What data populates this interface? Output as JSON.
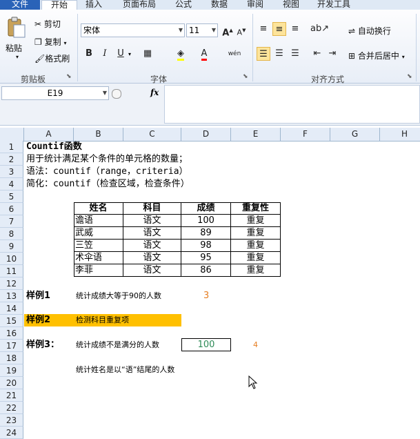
{
  "tabs": [
    "文件",
    "开始",
    "插入",
    "页面布局",
    "公式",
    "数据",
    "审阅",
    "视图",
    "开发工具"
  ],
  "clipboard": {
    "paste": "粘贴",
    "cut": "剪切",
    "copy": "复制",
    "painter": "格式刷",
    "group": "剪贴板"
  },
  "font": {
    "name": "宋体",
    "size": "11",
    "group": "字体",
    "bold": "B",
    "italic": "I",
    "underline": "U",
    "grow": "A",
    "shrink": "A"
  },
  "align": {
    "wrap": "自动换行",
    "merge": "合并后居中",
    "group": "对齐方式"
  },
  "formula_bar": {
    "name_box": "E19",
    "fx": "fx",
    "content": ""
  },
  "columns": [
    "A",
    "B",
    "C",
    "D",
    "E",
    "F",
    "G",
    "H"
  ],
  "rows": [
    "1",
    "2",
    "3",
    "4",
    "5",
    "6",
    "7",
    "8",
    "9",
    "10",
    "11",
    "12",
    "13",
    "14",
    "15",
    "16",
    "17",
    "18",
    "19",
    "20",
    "21",
    "22",
    "23",
    "24"
  ],
  "text_lines": {
    "r1": "Countif函数",
    "r2": "用于统计满足某个条件的单元格的数量；",
    "r3": "语法：countif（range，criteria）",
    "r4": "简化：countif（检查区域，检查条件）"
  },
  "table": {
    "headers": [
      "姓名",
      "科目",
      "成绩",
      "重复性"
    ],
    "rows": [
      [
        "谵语",
        "语文",
        "100",
        "重复"
      ],
      [
        "武威",
        "语文",
        "89",
        "重复"
      ],
      [
        "三笠",
        "语文",
        "98",
        "重复"
      ],
      [
        "术伞语",
        "语文",
        "95",
        "重复"
      ],
      [
        "李菲",
        "语文",
        "86",
        "重复"
      ]
    ]
  },
  "examples": {
    "e1_label": "样例1",
    "e1_desc": "统计成绩大等于90的人数",
    "e1_value": "3",
    "e2_label": "样例2",
    "e2_desc": "检测科目重复项",
    "e3_label": "样例3：",
    "e3_desc": "统计成绩不是满分的人数",
    "e3_value": "100",
    "e3_result": "4",
    "e4_desc": "统计姓名是以“语”结尾的人数"
  },
  "colors": {
    "highlight": "#ffc000",
    "orange": "#e67e22",
    "green": "#2e8b57"
  }
}
